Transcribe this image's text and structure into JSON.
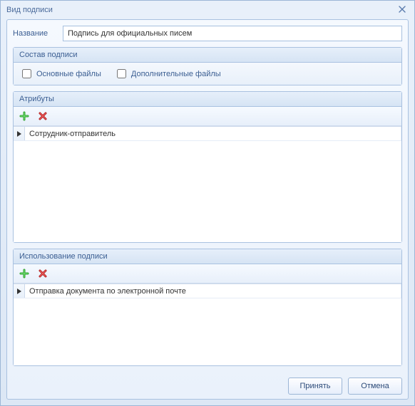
{
  "window": {
    "title": "Вид подписи"
  },
  "name_row": {
    "label": "Название",
    "value": "Подпись для официальных писем"
  },
  "composition": {
    "title": "Состав подписи",
    "main_files_label": "Основные файлы",
    "extra_files_label": "Дополнительные файлы",
    "main_checked": false,
    "extra_checked": false
  },
  "attributes": {
    "title": "Атрибуты",
    "rows": [
      {
        "text": "Сотрудник-отправитель"
      }
    ]
  },
  "usage": {
    "title": "Использование подписи",
    "rows": [
      {
        "text": "Отправка документа по электронной почте"
      }
    ]
  },
  "footer": {
    "ok": "Принять",
    "cancel": "Отмена"
  }
}
